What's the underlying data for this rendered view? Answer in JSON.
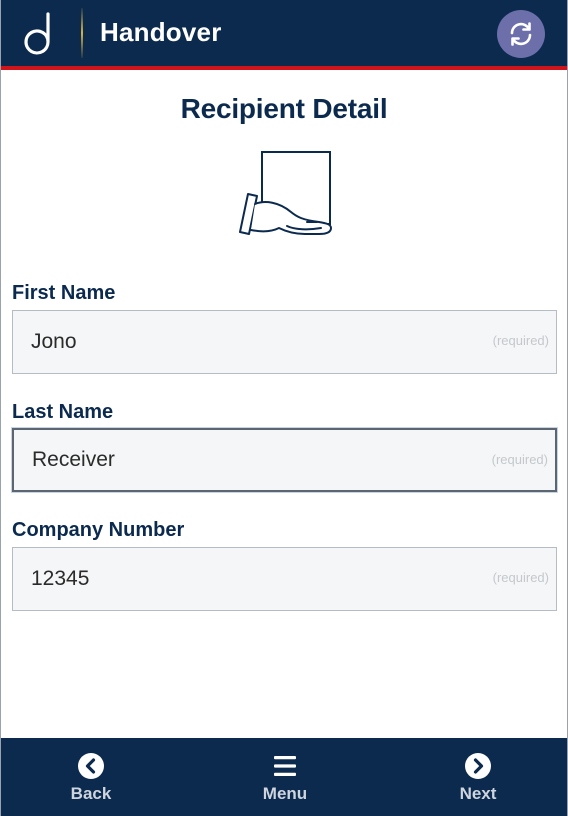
{
  "header": {
    "title": "Handover",
    "logo_icon": "letter-d-logo",
    "sync_icon": "sync-icon"
  },
  "page": {
    "title": "Recipient Detail",
    "illustration_icon": "hand-holding-document-icon"
  },
  "form": {
    "first_name": {
      "label": "First Name",
      "value": "Jono",
      "hint": "(required)"
    },
    "last_name": {
      "label": "Last Name",
      "value": "Receiver",
      "hint": "(required)"
    },
    "company_number": {
      "label": "Company Number",
      "value": "12345",
      "hint": "(required)"
    }
  },
  "footer": {
    "back_label": "Back",
    "menu_label": "Menu",
    "next_label": "Next"
  },
  "colors": {
    "brand_navy": "#0b2a4e",
    "accent_red": "#d0141c",
    "sync_purple": "#6c6faa",
    "field_bg": "#f5f6f7"
  }
}
